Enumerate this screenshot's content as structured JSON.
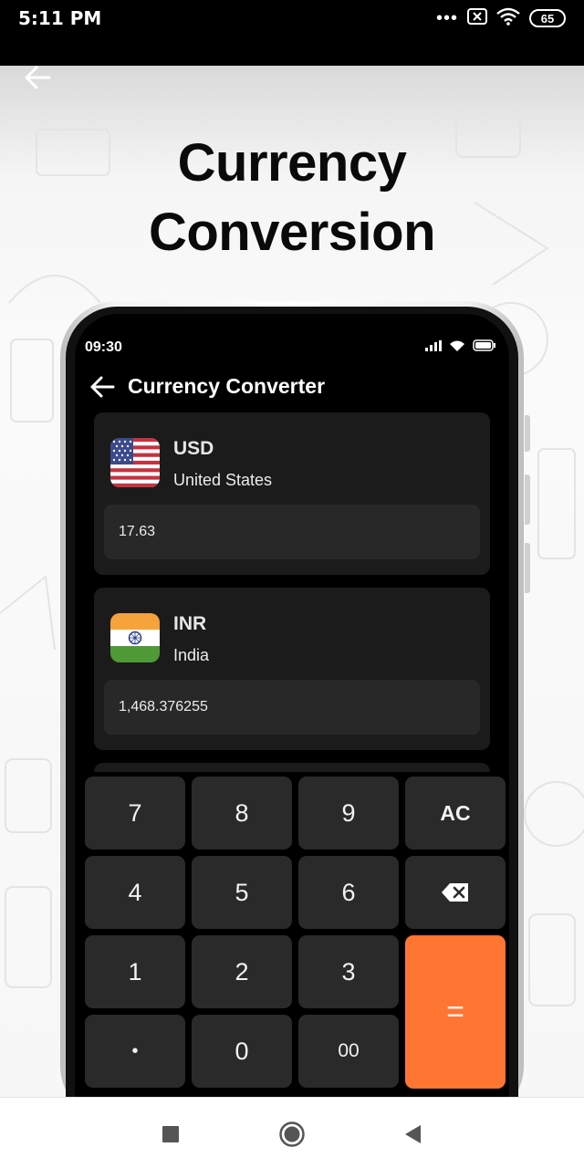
{
  "status_bar": {
    "time": "5:11 PM",
    "dots": "•••",
    "battery": "65"
  },
  "promo": {
    "headline_line1": "Currency",
    "headline_line2": "Conversion"
  },
  "phone": {
    "status_time": "09:30",
    "title": "Currency Converter",
    "cards": [
      {
        "code": "USD",
        "country": "United States",
        "amount": "17.63",
        "flag": "us-flag-icon"
      },
      {
        "code": "INR",
        "country": "India",
        "amount": "1,468.376255",
        "flag": "india-flag-icon"
      }
    ],
    "keypad": {
      "k7": "7",
      "k8": "8",
      "k9": "9",
      "ac": "AC",
      "k4": "4",
      "k5": "5",
      "k6": "6",
      "k1": "1",
      "k2": "2",
      "k3": "3",
      "dot": "•",
      "k0": "0",
      "k00": "00",
      "eq": "="
    }
  },
  "colors": {
    "accent": "#ff7532",
    "card": "#1b1b1b",
    "field": "#282828",
    "key": "#2a2a2a"
  }
}
